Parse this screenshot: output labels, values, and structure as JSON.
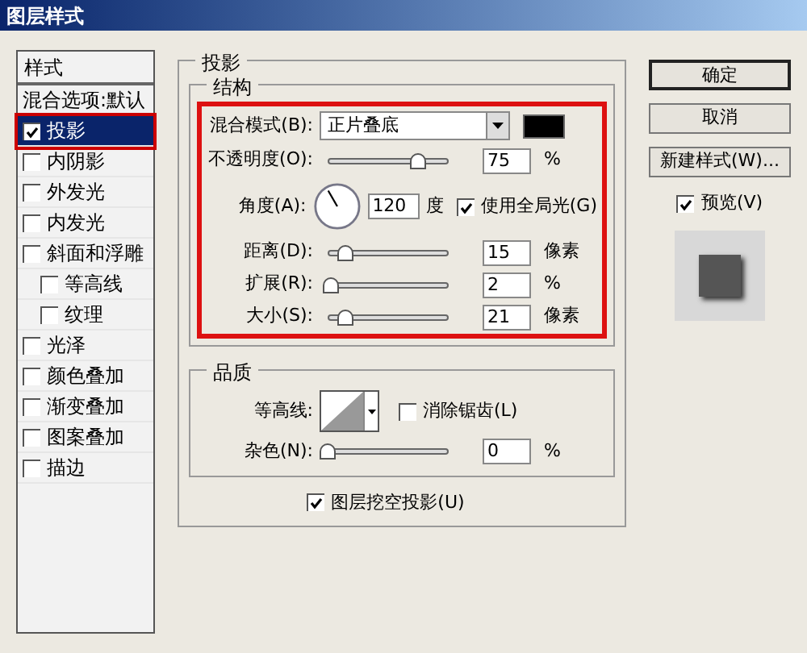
{
  "window": {
    "title": "图层样式"
  },
  "styles_list": {
    "header": "样式",
    "items": [
      {
        "kind": "plain",
        "label": "混合选项:默认",
        "selected": false
      },
      {
        "kind": "check",
        "label": "投影",
        "checked": true,
        "selected": true
      },
      {
        "kind": "check",
        "label": "内阴影",
        "checked": false,
        "selected": false
      },
      {
        "kind": "check",
        "label": "外发光",
        "checked": false,
        "selected": false
      },
      {
        "kind": "check",
        "label": "内发光",
        "checked": false,
        "selected": false
      },
      {
        "kind": "check",
        "label": "斜面和浮雕",
        "checked": false,
        "selected": false,
        "children": [
          {
            "kind": "check",
            "label": "等高线",
            "checked": false,
            "selected": false
          },
          {
            "kind": "check",
            "label": "纹理",
            "checked": false,
            "selected": false
          }
        ]
      },
      {
        "kind": "check",
        "label": "光泽",
        "checked": false,
        "selected": false
      },
      {
        "kind": "check",
        "label": "颜色叠加",
        "checked": false,
        "selected": false
      },
      {
        "kind": "check",
        "label": "渐变叠加",
        "checked": false,
        "selected": false
      },
      {
        "kind": "check",
        "label": "图案叠加",
        "checked": false,
        "selected": false
      },
      {
        "kind": "check",
        "label": "描边",
        "checked": false,
        "selected": false
      }
    ]
  },
  "panel": {
    "title": "投影",
    "structure": {
      "title": "结构",
      "blend_mode": {
        "label": "混合模式(B):",
        "value": "正片叠底",
        "color": "#000000"
      },
      "rows": [
        {
          "kind": "slider",
          "label": "不透明度(O):",
          "level": 0.75,
          "value": "75",
          "unit": "%"
        },
        {
          "kind": "angle",
          "label": "角度(A):",
          "value": "120",
          "unit": "度",
          "global_light": {
            "label": "使用全局光(G)",
            "checked": true
          }
        },
        {
          "kind": "slider",
          "label": "距离(D):",
          "level": 0.15,
          "value": "15",
          "unit": "像素"
        },
        {
          "kind": "slider",
          "label": "扩展(R):",
          "level": 0.02,
          "value": "2",
          "unit": "%"
        },
        {
          "kind": "slider",
          "label": "大小(S):",
          "level": 0.15,
          "value": "21",
          "unit": "像素"
        }
      ]
    },
    "quality": {
      "title": "品质",
      "contour": {
        "label": "等高线:",
        "anti_alias": {
          "label": "消除锯齿(L)",
          "checked": false
        }
      },
      "noise": {
        "label": "杂色(N):",
        "level": 0,
        "value": "0",
        "unit": "%"
      }
    },
    "knockout": {
      "label": "图层挖空投影(U)",
      "checked": true
    }
  },
  "buttons": [
    {
      "label": "确定",
      "default": true
    },
    {
      "label": "取消",
      "default": false
    },
    {
      "label": "新建样式(W)...",
      "default": false
    }
  ],
  "preview": {
    "label": "预览(V)",
    "checked": true
  }
}
